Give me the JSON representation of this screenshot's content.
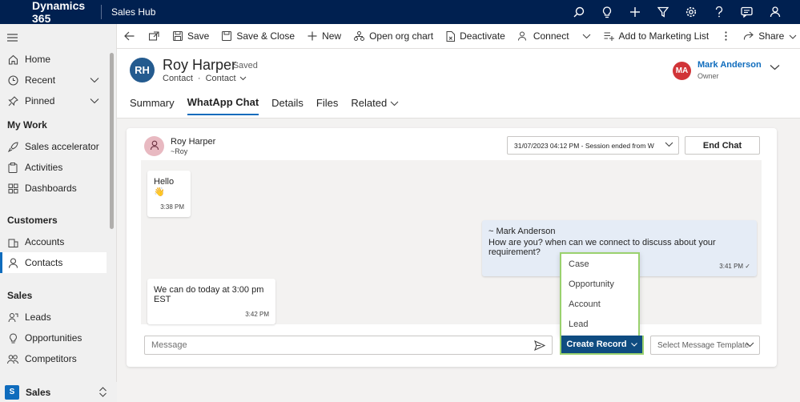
{
  "app": {
    "brand": "Dynamics 365",
    "hub": "Sales Hub"
  },
  "topbar_icons": [
    "search-icon",
    "lightbulb-icon",
    "plus-icon",
    "filter-icon",
    "gear-icon",
    "help-icon",
    "chat-icon",
    "person-feedback-icon"
  ],
  "sidebar": {
    "home": "Home",
    "recent": "Recent",
    "pinned": "Pinned",
    "my_work": "My Work",
    "sales_accelerator": "Sales accelerator",
    "activities": "Activities",
    "dashboards": "Dashboards",
    "customers": "Customers",
    "accounts": "Accounts",
    "contacts": "Contacts",
    "sales": "Sales",
    "leads": "Leads",
    "opportunities": "Opportunities",
    "competitors": "Competitors",
    "area_badge": "S",
    "area_name": "Sales"
  },
  "commands": {
    "save": "Save",
    "save_close": "Save & Close",
    "new": "New",
    "open_org_chart": "Open org chart",
    "deactivate": "Deactivate",
    "connect": "Connect",
    "add_marketing": "Add to Marketing List",
    "share": "Share"
  },
  "record": {
    "initials": "RH",
    "name": "Roy Harper",
    "saved": "- Saved",
    "entity": "Contact",
    "dot": "·",
    "form": "Contact",
    "owner_initials": "MA",
    "owner_name": "Mark Anderson",
    "owner_role": "Owner"
  },
  "tabs": [
    "Summary",
    "WhatApp Chat",
    "Details",
    "Files",
    "Related"
  ],
  "chat": {
    "contact_name": "Roy Harper",
    "contact_handle": "~Roy",
    "session": "31/07/2023 04:12 PM - Session ended from W",
    "end_chat": "End Chat",
    "messages": [
      {
        "text": "Hello 👋",
        "time": "3:38 PM"
      },
      {
        "sender": "~ Mark Anderson",
        "text": "How are you? when can we connect to discuss about your requirement?",
        "time": "3:41 PM ✓"
      },
      {
        "text": "We can do today at 3:00 pm EST",
        "time": "3:42 PM"
      }
    ],
    "message_placeholder": "Message",
    "create_record": "Create Record",
    "template_placeholder": "Select Message Template",
    "record_menu": [
      "Case",
      "Opportunity",
      "Account",
      "Lead"
    ]
  },
  "colors": {
    "topbar": "#002050",
    "accent": "#0f6cbd",
    "highlight": "#9ad16e",
    "owner_avatar": "#d13438"
  }
}
